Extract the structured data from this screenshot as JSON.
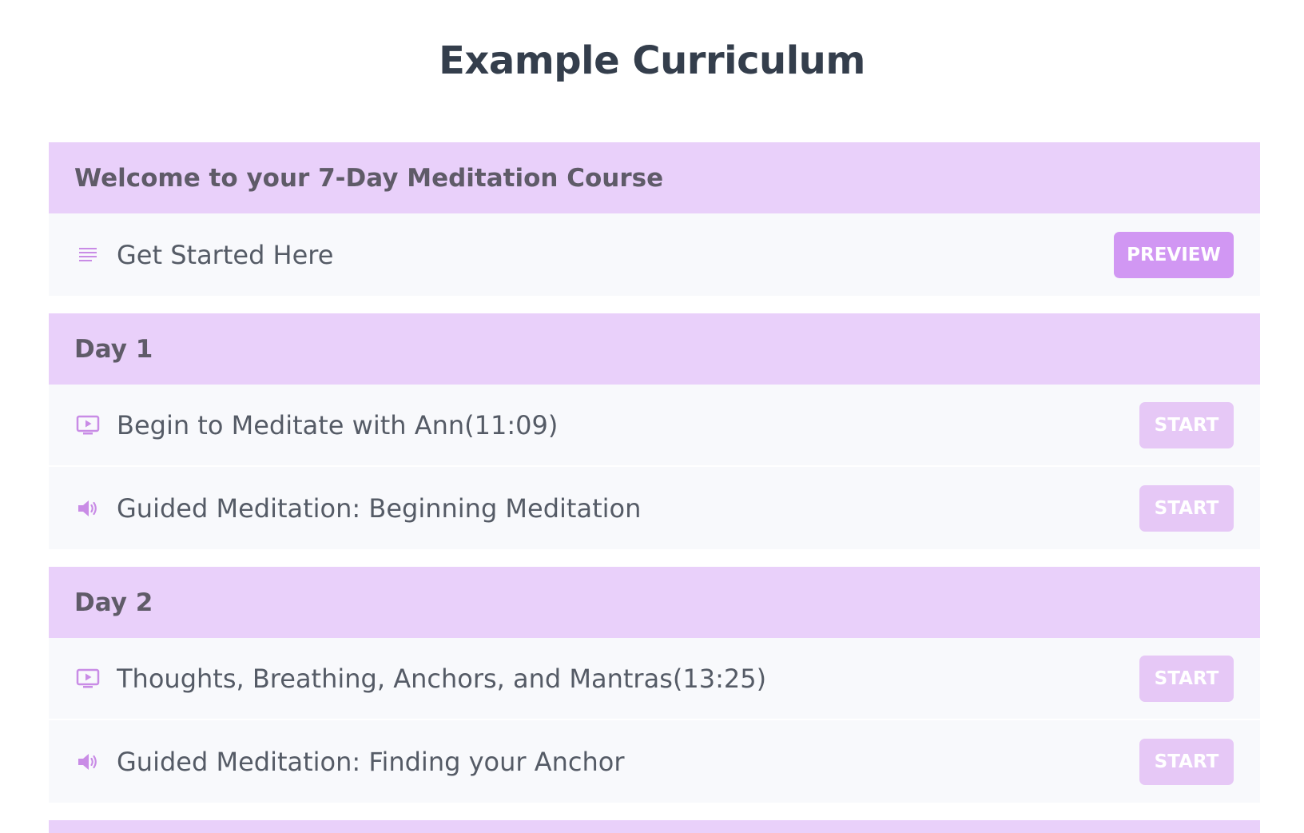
{
  "page": {
    "title": "Example Curriculum"
  },
  "colors": {
    "section_header_bg": "#e9d0fa",
    "lecture_bg": "#f8f9fc",
    "preview_button": "#d197f3",
    "start_button": "#e6c8f6",
    "icon_accent": "#c98ce6"
  },
  "sections": [
    {
      "title": "Welcome to your 7-Day Meditation Course",
      "lectures": [
        {
          "icon": "text-lines-icon",
          "title": "Get Started Here",
          "action": "PREVIEW"
        }
      ]
    },
    {
      "title": "Day 1",
      "lectures": [
        {
          "icon": "video-play-icon",
          "title": "Begin to Meditate with Ann(11:09)",
          "action": "START"
        },
        {
          "icon": "speaker-icon",
          "title": "Guided Meditation: Beginning Meditation",
          "action": "START"
        }
      ]
    },
    {
      "title": "Day 2",
      "lectures": [
        {
          "icon": "video-play-icon",
          "title": "Thoughts, Breathing, Anchors, and Mantras(13:25)",
          "action": "START"
        },
        {
          "icon": "speaker-icon",
          "title": "Guided Meditation: Finding your Anchor",
          "action": "START"
        }
      ]
    }
  ]
}
